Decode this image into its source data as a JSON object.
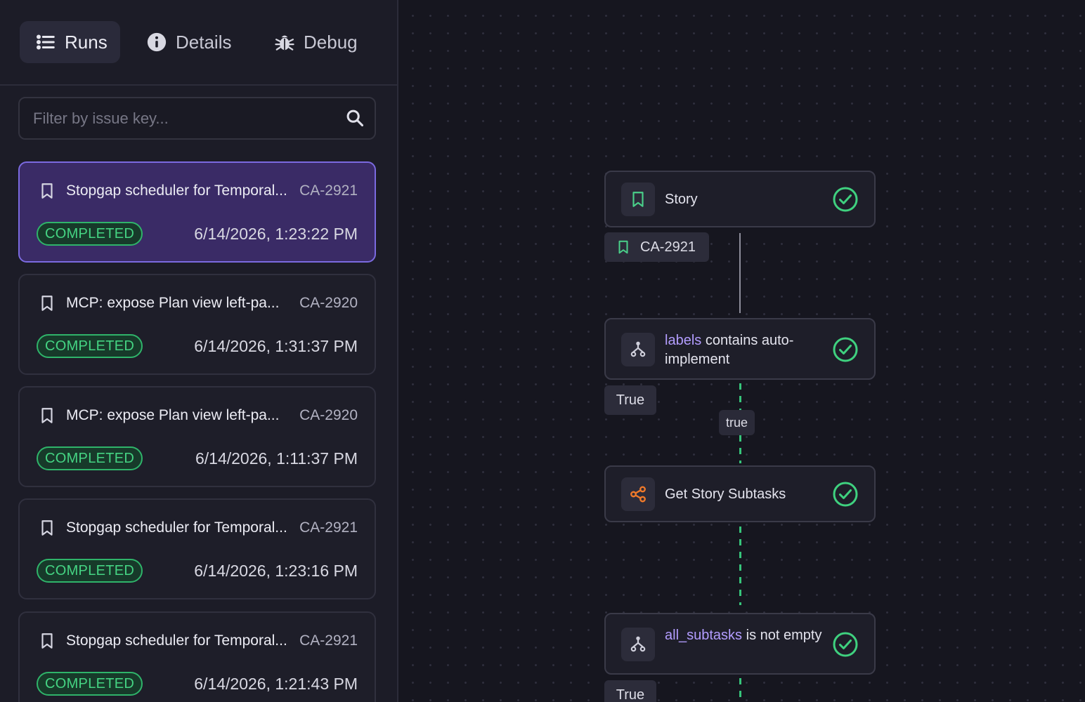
{
  "tabs": [
    {
      "label": "Runs",
      "active": true
    },
    {
      "label": "Details",
      "active": false
    },
    {
      "label": "Debug",
      "active": false
    }
  ],
  "search": {
    "placeholder": "Filter by issue key..."
  },
  "runs": [
    {
      "title": "Stopgap scheduler for Temporal...",
      "key": "CA-2921",
      "status": "COMPLETED",
      "time": "6/14/2026, 1:23:22 PM",
      "selected": true
    },
    {
      "title": "MCP: expose Plan view left-pa...",
      "key": "CA-2920",
      "status": "COMPLETED",
      "time": "6/14/2026, 1:31:37 PM",
      "selected": false
    },
    {
      "title": "MCP: expose Plan view left-pa...",
      "key": "CA-2920",
      "status": "COMPLETED",
      "time": "6/14/2026, 1:11:37 PM",
      "selected": false
    },
    {
      "title": "Stopgap scheduler for Temporal...",
      "key": "CA-2921",
      "status": "COMPLETED",
      "time": "6/14/2026, 1:23:16 PM",
      "selected": false
    },
    {
      "title": "Stopgap scheduler for Temporal...",
      "key": "CA-2921",
      "status": "COMPLETED",
      "time": "6/14/2026, 1:21:43 PM",
      "selected": false
    }
  ],
  "flow": {
    "story_node": {
      "label": "Story"
    },
    "issue_tag": {
      "label": "CA-2921"
    },
    "condition1": {
      "field": "labels",
      "text": " contains auto-implement"
    },
    "branch1_tag": "True",
    "edge_label": "true",
    "action_node": {
      "label": "Get Story Subtasks"
    },
    "condition2": {
      "field": "all_subtasks",
      "text": " is not empty"
    },
    "branch2_tag": "True"
  },
  "colors": {
    "accent": "#7b6ae0",
    "success": "#45d483",
    "field_highlight": "#b39dff",
    "action_icon": "#f07a2a"
  },
  "icons": {
    "tab_runs": "list-icon",
    "tab_details": "info-icon",
    "tab_debug": "bug-icon",
    "search": "search-icon",
    "run_item": "bookmark-icon",
    "node_status": "check-circle-icon",
    "condition": "branch-icon",
    "action": "share-icon"
  }
}
